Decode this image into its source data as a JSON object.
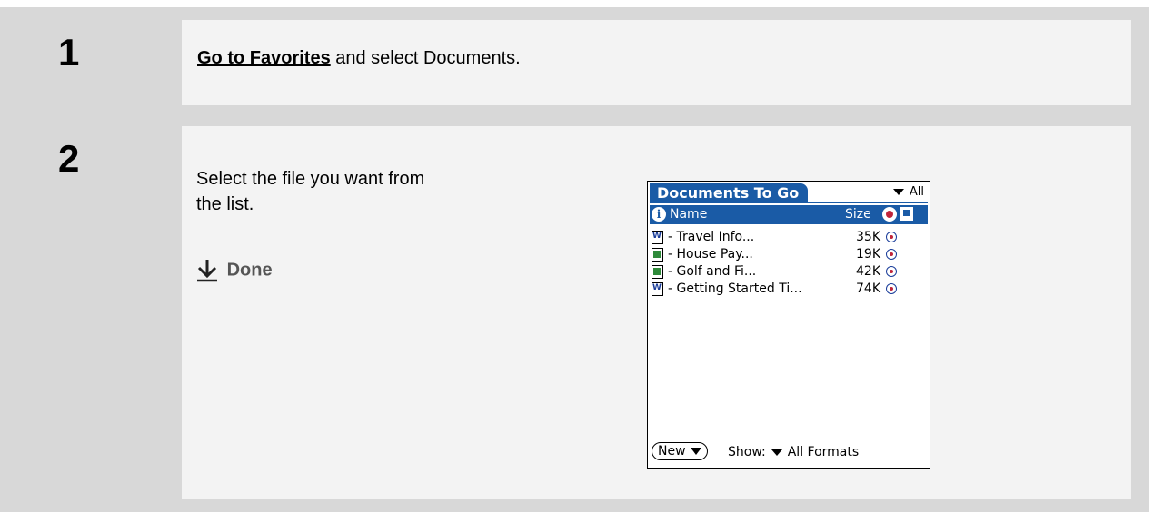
{
  "steps": [
    {
      "number": "1",
      "link_text": "Go to Favorites",
      "text_after": " and select Documents."
    },
    {
      "number": "2",
      "text": "Select the file you want from the list.",
      "done_label": "Done",
      "done_icon": "down-arrow-icon"
    }
  ],
  "device": {
    "title": "Documents To Go",
    "category": "All",
    "columns": {
      "info_icon": "i",
      "name": "Name",
      "size": "Size"
    },
    "files": [
      {
        "icon": "word-doc-icon",
        "name": "- Travel Info...",
        "size": "35K"
      },
      {
        "icon": "spreadsheet-icon",
        "name": "- House Pay...",
        "size": "19K"
      },
      {
        "icon": "spreadsheet-icon",
        "name": "- Golf and Fi...",
        "size": "42K"
      },
      {
        "icon": "word-doc-icon",
        "name": "- Getting Started Ti...",
        "size": "74K"
      }
    ],
    "footer": {
      "new_button": "New",
      "show_label": "Show:",
      "show_value": "All Formats"
    }
  },
  "colors": {
    "title_bar": "#1a5ba6",
    "frame": "#d8d8d8",
    "panel": "#f3f3f3",
    "sync_dot": "#c0243a"
  }
}
